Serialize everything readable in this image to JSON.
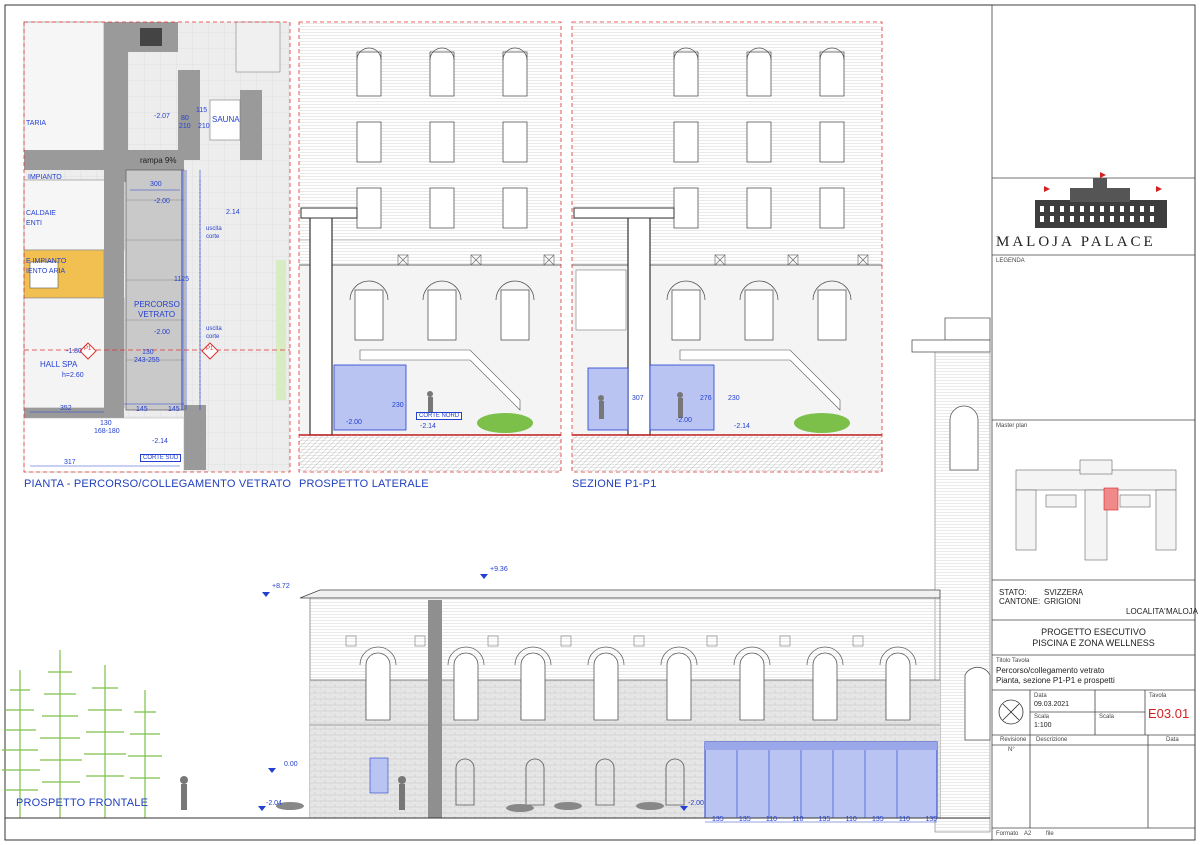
{
  "views": {
    "plan_title": "PIANTA - PERCORSO/COLLEGAMENTO VETRATO",
    "lateral_title": "PROSPETTO LATERALE",
    "section_title": "SEZIONE P1-P1",
    "front_title": "PROSPETTO FRONTALE"
  },
  "plan": {
    "rooms": {
      "sauna": "SAUNA",
      "hall_spa": "HALL SPA",
      "percorso": "PERCORSO",
      "vetrato": "VETRATO",
      "caldaie": "CALDAIE",
      "enti": "ENTI",
      "impianto": "E IMPIANTO",
      "aria": "IENTO ARIA",
      "impianto_top": "IMPIANTO",
      "taria": "TARIA",
      "corte_sud": "CORTE SUD",
      "rampa": "rampa 9%",
      "uscita1": "uscita",
      "corte1": "corte",
      "uscita2": "uscita",
      "corte2": "corte"
    },
    "tags": {
      "p1_left": "P1",
      "p1_right": "P1"
    },
    "dims": {
      "d_207": "-2.07",
      "d_115": "115",
      "d_80": "80",
      "d_210a": "210",
      "d_210b": "210",
      "d_300": "300",
      "d_200a": "-2.00",
      "d_214a": "2.14",
      "d_1125": "1125",
      "d_200b": "-2.00",
      "d_130": "130",
      "d_243": "243-255",
      "d_352": "352",
      "d_145a": "145",
      "d_145b": "145",
      "d_130b": "130",
      "d_168": "168-180",
      "d_214b": "-2.14",
      "d_317": "317",
      "d_180": "-1.80",
      "d_260": "h=2.60"
    }
  },
  "elevations": {
    "corte_nord_lateral": "CORTE NORD",
    "lat_d_200": "-2.00",
    "lat_d_214": "-2.14",
    "lat_d_230": "230",
    "sec_d_200": "-2.00",
    "sec_d_214": "-2.14",
    "sec_d_307": "307",
    "sec_d_276": "276",
    "sec_d_230": "230",
    "front_d_872": "+8.72",
    "front_d_936": "+9.36",
    "front_d_000": "0.00",
    "front_d_204": "-2.04",
    "front_d_200": "-2.00",
    "front_spacing": [
      "135",
      "135",
      "110",
      "110",
      "135",
      "110",
      "135",
      "110",
      "135"
    ]
  },
  "titleblock": {
    "brand": "MALOJA PALACE",
    "legenda": "LEGENDA",
    "master_plan": "Master plan",
    "stato_label": "STATO:",
    "stato_value": "SVIZZERA",
    "cantone_label": "CANTONE:",
    "cantone_value": "GRIGIONI",
    "localita_label": "LOCALITA':",
    "localita_value": "MALOJA",
    "project_line1": "PROGETTO ESECUTIVO",
    "project_line2": "PISCINA E ZONA WELLNESS",
    "titolo_label": "Titolo Tavola",
    "titolo_line1": "Percorso/collegamento vetrato",
    "titolo_line2": "Pianta, sezione P1-P1 e prospetti",
    "data_label": "Data",
    "data_value": "09.03.2021",
    "scala_label": "Scala",
    "scala_value": "1:100",
    "scala_label2": "Scala",
    "tavola_label": "Tavola",
    "tavola_value": "E03.01",
    "revisione_label": "Revisione",
    "descrizione_label": "Descrizione",
    "data_rev_label": "Data",
    "n_label": "N°",
    "formato_label": "Formato",
    "formato_value": "A2",
    "file_label": "file"
  },
  "colors": {
    "dim_blue": "#2440d0",
    "title_blue": "#1f3fbf",
    "frame_red": "#e03030",
    "glass_blue": "#b9c4f2",
    "duct_orange": "#f2c050",
    "plant_green": "#7cc04a",
    "tavola_red": "#d42020"
  }
}
